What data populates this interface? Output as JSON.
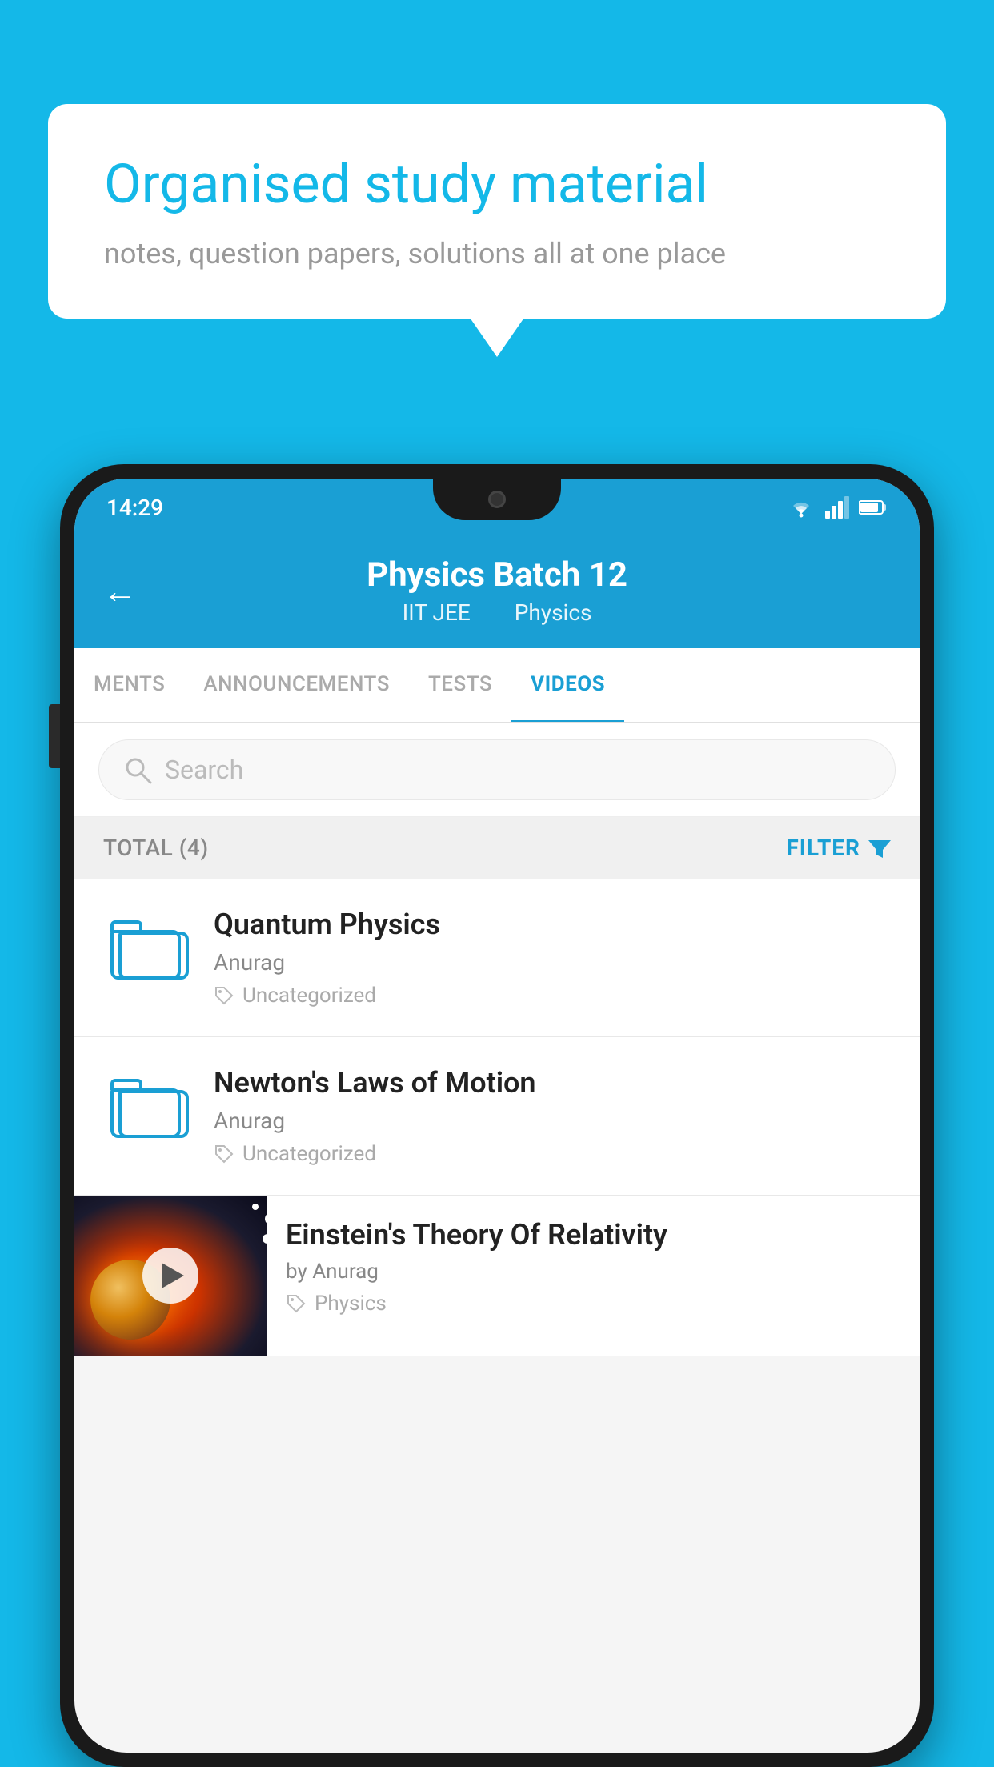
{
  "background_color": "#14b8e8",
  "speech_bubble": {
    "title": "Organised study material",
    "subtitle": "notes, question papers, solutions all at one place"
  },
  "phone": {
    "status_bar": {
      "time": "14:29",
      "icons": [
        "wifi",
        "signal",
        "battery"
      ]
    },
    "header": {
      "back_label": "←",
      "title": "Physics Batch 12",
      "subtitle_left": "IIT JEE",
      "subtitle_right": "Physics"
    },
    "tabs": [
      {
        "label": "MENTS",
        "active": false
      },
      {
        "label": "ANNOUNCEMENTS",
        "active": false
      },
      {
        "label": "TESTS",
        "active": false
      },
      {
        "label": "VIDEOS",
        "active": true
      }
    ],
    "search": {
      "placeholder": "Search"
    },
    "filter_row": {
      "total_label": "TOTAL (4)",
      "filter_label": "FILTER"
    },
    "video_items": [
      {
        "title": "Quantum Physics",
        "author": "Anurag",
        "tag": "Uncategorized",
        "type": "folder"
      },
      {
        "title": "Newton's Laws of Motion",
        "author": "Anurag",
        "tag": "Uncategorized",
        "type": "folder"
      },
      {
        "title": "Einstein's Theory Of Relativity",
        "author": "by Anurag",
        "tag": "Physics",
        "type": "video"
      }
    ]
  }
}
